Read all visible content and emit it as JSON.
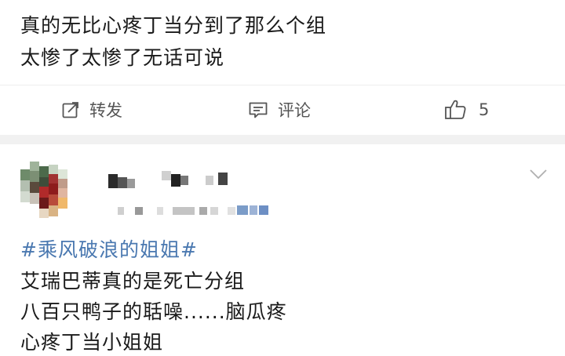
{
  "post1": {
    "line1": "真的无比心疼丁当分到了那么个组",
    "line2": "太惨了太惨了无话可说",
    "actions": {
      "repost_label": "转发",
      "comment_label": "评论",
      "like_count": "5"
    }
  },
  "post2": {
    "hashtag": "#乘风破浪的姐姐#",
    "lines": [
      "艾瑞巴蒂真的是死亡分组",
      "八百只鸭子的聒噪......脑瓜疼",
      "心疼丁当小姐姐"
    ]
  },
  "colors": {
    "hashtag": "#4a78b0",
    "action_text": "#555555",
    "separator": "#f1f1f1"
  },
  "icons": [
    "repost-icon",
    "comment-icon",
    "thumbs-up-icon",
    "chevron-down-icon"
  ]
}
